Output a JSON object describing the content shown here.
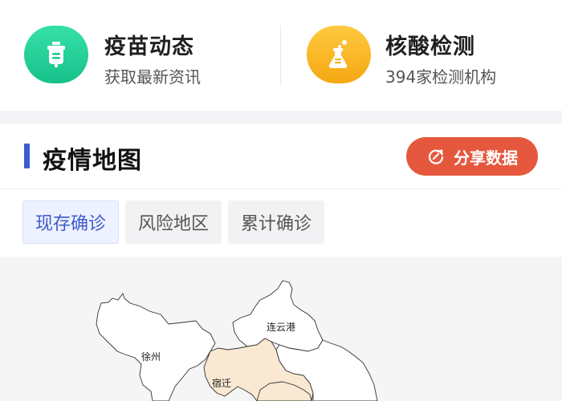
{
  "quick_links": [
    {
      "title": "疫苗动态",
      "subtitle": "获取最新资讯",
      "icon": "vaccine-icon",
      "color": "#1cc88f"
    },
    {
      "title": "核酸检测",
      "subtitle": "394家检测机构",
      "icon": "flask-icon",
      "color": "#f8b21f"
    }
  ],
  "map_section": {
    "title": "疫情地图",
    "share_label": "分享数据",
    "share_color": "#e5583d",
    "accent_color": "#3b5ccc",
    "tabs": [
      {
        "label": "现存确诊",
        "active": true
      },
      {
        "label": "风险地区",
        "active": false
      },
      {
        "label": "累计确诊",
        "active": false
      }
    ],
    "cities": [
      {
        "name": "连云港",
        "highlighted": false
      },
      {
        "name": "徐州",
        "highlighted": false
      },
      {
        "name": "宿迁",
        "highlighted": true
      }
    ],
    "highlight_color": "#f9e8d2"
  }
}
